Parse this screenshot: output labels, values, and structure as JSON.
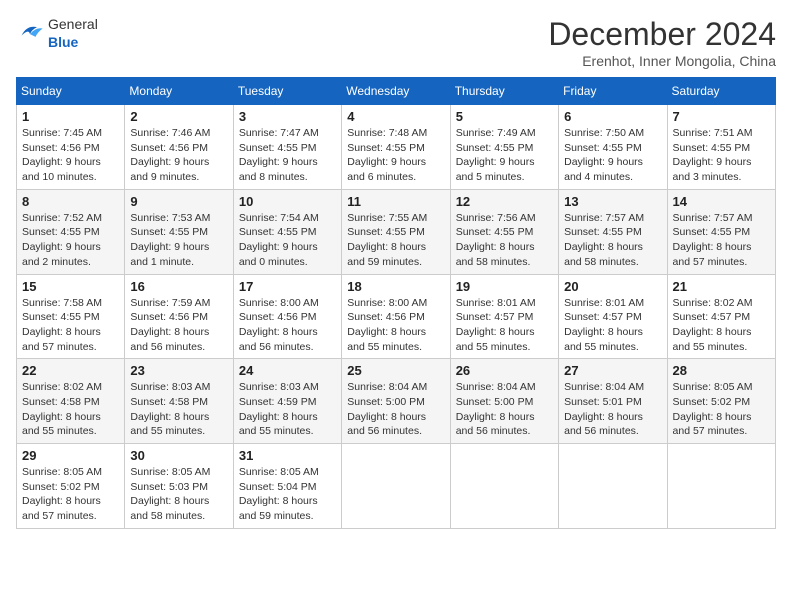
{
  "logo": {
    "general": "General",
    "blue": "Blue"
  },
  "title": "December 2024",
  "subtitle": "Erenhot, Inner Mongolia, China",
  "days_of_week": [
    "Sunday",
    "Monday",
    "Tuesday",
    "Wednesday",
    "Thursday",
    "Friday",
    "Saturday"
  ],
  "weeks": [
    [
      {
        "day": 1,
        "sunrise": "7:45 AM",
        "sunset": "4:56 PM",
        "daylight": "9 hours and 10 minutes."
      },
      {
        "day": 2,
        "sunrise": "7:46 AM",
        "sunset": "4:56 PM",
        "daylight": "9 hours and 9 minutes."
      },
      {
        "day": 3,
        "sunrise": "7:47 AM",
        "sunset": "4:55 PM",
        "daylight": "9 hours and 8 minutes."
      },
      {
        "day": 4,
        "sunrise": "7:48 AM",
        "sunset": "4:55 PM",
        "daylight": "9 hours and 6 minutes."
      },
      {
        "day": 5,
        "sunrise": "7:49 AM",
        "sunset": "4:55 PM",
        "daylight": "9 hours and 5 minutes."
      },
      {
        "day": 6,
        "sunrise": "7:50 AM",
        "sunset": "4:55 PM",
        "daylight": "9 hours and 4 minutes."
      },
      {
        "day": 7,
        "sunrise": "7:51 AM",
        "sunset": "4:55 PM",
        "daylight": "9 hours and 3 minutes."
      }
    ],
    [
      {
        "day": 8,
        "sunrise": "7:52 AM",
        "sunset": "4:55 PM",
        "daylight": "9 hours and 2 minutes."
      },
      {
        "day": 9,
        "sunrise": "7:53 AM",
        "sunset": "4:55 PM",
        "daylight": "9 hours and 1 minute."
      },
      {
        "day": 10,
        "sunrise": "7:54 AM",
        "sunset": "4:55 PM",
        "daylight": "9 hours and 0 minutes."
      },
      {
        "day": 11,
        "sunrise": "7:55 AM",
        "sunset": "4:55 PM",
        "daylight": "8 hours and 59 minutes."
      },
      {
        "day": 12,
        "sunrise": "7:56 AM",
        "sunset": "4:55 PM",
        "daylight": "8 hours and 58 minutes."
      },
      {
        "day": 13,
        "sunrise": "7:57 AM",
        "sunset": "4:55 PM",
        "daylight": "8 hours and 58 minutes."
      },
      {
        "day": 14,
        "sunrise": "7:57 AM",
        "sunset": "4:55 PM",
        "daylight": "8 hours and 57 minutes."
      }
    ],
    [
      {
        "day": 15,
        "sunrise": "7:58 AM",
        "sunset": "4:55 PM",
        "daylight": "8 hours and 57 minutes."
      },
      {
        "day": 16,
        "sunrise": "7:59 AM",
        "sunset": "4:56 PM",
        "daylight": "8 hours and 56 minutes."
      },
      {
        "day": 17,
        "sunrise": "8:00 AM",
        "sunset": "4:56 PM",
        "daylight": "8 hours and 56 minutes."
      },
      {
        "day": 18,
        "sunrise": "8:00 AM",
        "sunset": "4:56 PM",
        "daylight": "8 hours and 55 minutes."
      },
      {
        "day": 19,
        "sunrise": "8:01 AM",
        "sunset": "4:57 PM",
        "daylight": "8 hours and 55 minutes."
      },
      {
        "day": 20,
        "sunrise": "8:01 AM",
        "sunset": "4:57 PM",
        "daylight": "8 hours and 55 minutes."
      },
      {
        "day": 21,
        "sunrise": "8:02 AM",
        "sunset": "4:57 PM",
        "daylight": "8 hours and 55 minutes."
      }
    ],
    [
      {
        "day": 22,
        "sunrise": "8:02 AM",
        "sunset": "4:58 PM",
        "daylight": "8 hours and 55 minutes."
      },
      {
        "day": 23,
        "sunrise": "8:03 AM",
        "sunset": "4:58 PM",
        "daylight": "8 hours and 55 minutes."
      },
      {
        "day": 24,
        "sunrise": "8:03 AM",
        "sunset": "4:59 PM",
        "daylight": "8 hours and 55 minutes."
      },
      {
        "day": 25,
        "sunrise": "8:04 AM",
        "sunset": "5:00 PM",
        "daylight": "8 hours and 56 minutes."
      },
      {
        "day": 26,
        "sunrise": "8:04 AM",
        "sunset": "5:00 PM",
        "daylight": "8 hours and 56 minutes."
      },
      {
        "day": 27,
        "sunrise": "8:04 AM",
        "sunset": "5:01 PM",
        "daylight": "8 hours and 56 minutes."
      },
      {
        "day": 28,
        "sunrise": "8:05 AM",
        "sunset": "5:02 PM",
        "daylight": "8 hours and 57 minutes."
      }
    ],
    [
      {
        "day": 29,
        "sunrise": "8:05 AM",
        "sunset": "5:02 PM",
        "daylight": "8 hours and 57 minutes."
      },
      {
        "day": 30,
        "sunrise": "8:05 AM",
        "sunset": "5:03 PM",
        "daylight": "8 hours and 58 minutes."
      },
      {
        "day": 31,
        "sunrise": "8:05 AM",
        "sunset": "5:04 PM",
        "daylight": "8 hours and 59 minutes."
      },
      null,
      null,
      null,
      null
    ]
  ]
}
